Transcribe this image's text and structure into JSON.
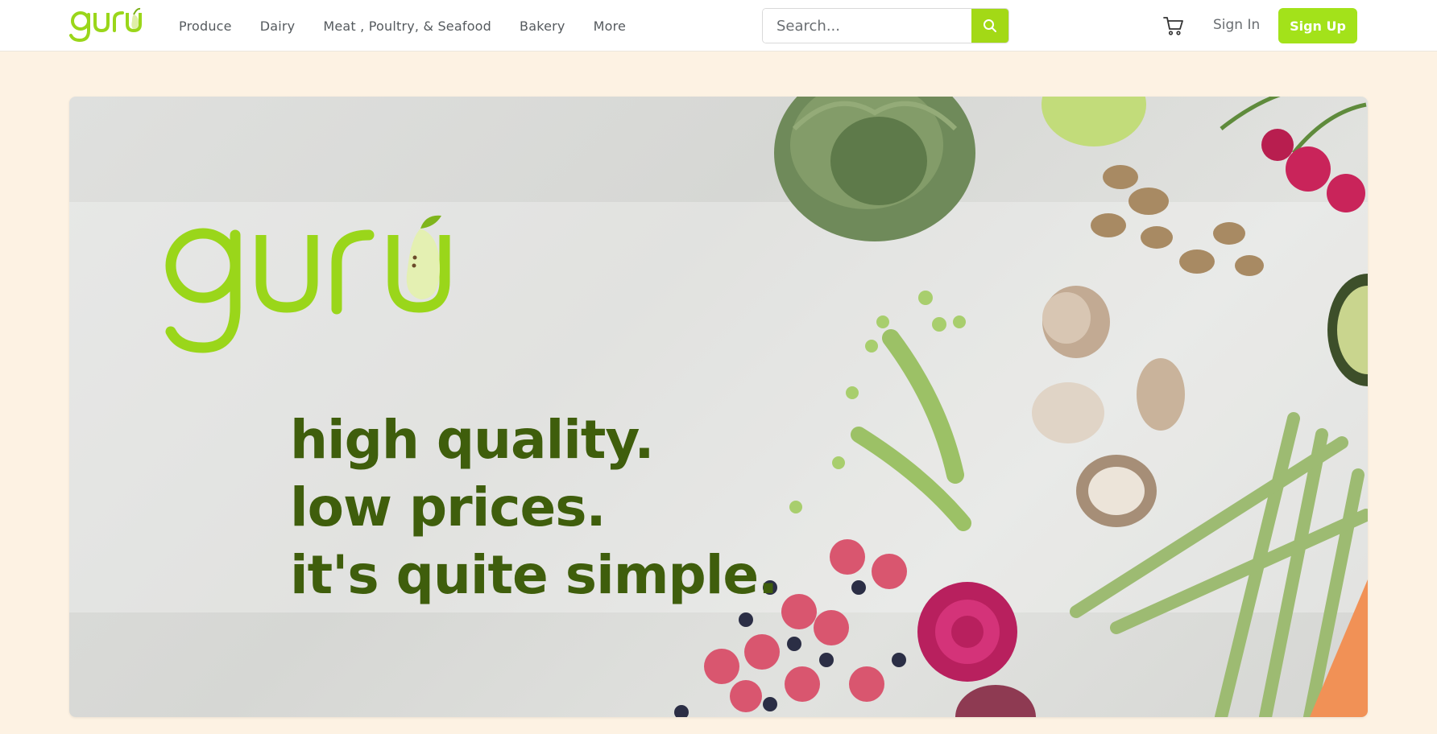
{
  "brand": {
    "logo_text": "guru",
    "accent": "#a3d916",
    "tagline_color": "#3f5e0c"
  },
  "nav": {
    "links": [
      "Produce",
      "Dairy",
      "Meat , Poultry, & Seafood",
      "Bakery",
      "More"
    ]
  },
  "search": {
    "placeholder": "Search...",
    "icon": "search-icon"
  },
  "header_actions": {
    "cart_icon": "cart-icon",
    "signin_label": "Sign In",
    "signup_label": "Sign Up"
  },
  "hero": {
    "lines": [
      "high quality.",
      "low prices.",
      "it's quite simple."
    ]
  }
}
